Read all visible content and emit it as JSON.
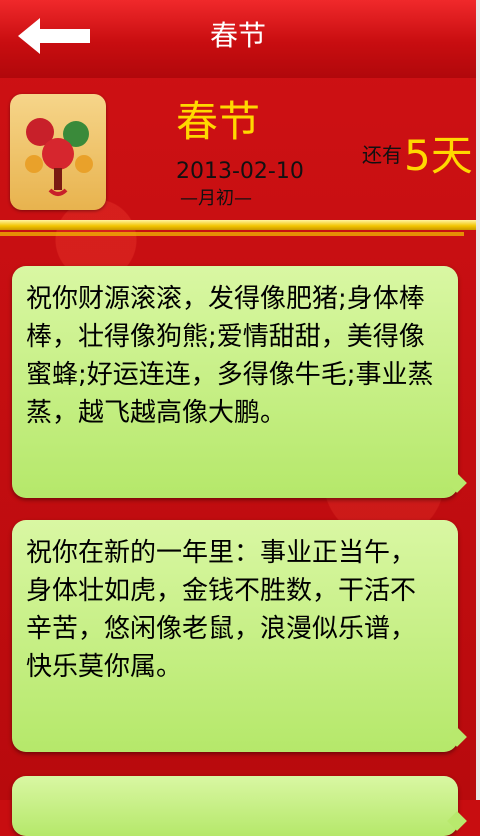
{
  "topbar": {
    "title": "春节"
  },
  "festival": {
    "name": "春节",
    "date": "2013-02-10",
    "lunar": "—月初—",
    "remaining_label": "还有",
    "remaining_days": "5天"
  },
  "messages": [
    "祝你财源滚滚，发得像肥猪;身体棒棒，壮得像狗熊;爱情甜甜，美得像蜜蜂;好运连连，多得像牛毛;事业蒸蒸，越飞越高像大鹏。",
    "祝你在新的一年里：事业正当午，身体壮如虎，金钱不胜数，干活不辛苦，悠闲像老鼠，浪漫似乐谱，快乐莫你属。"
  ],
  "icons": {
    "back": "back-arrow-icon",
    "festival": "spring-festival-icon"
  },
  "colors": {
    "accent": "#c80d10",
    "gold": "#ffd800",
    "card": "#c6ef85"
  }
}
